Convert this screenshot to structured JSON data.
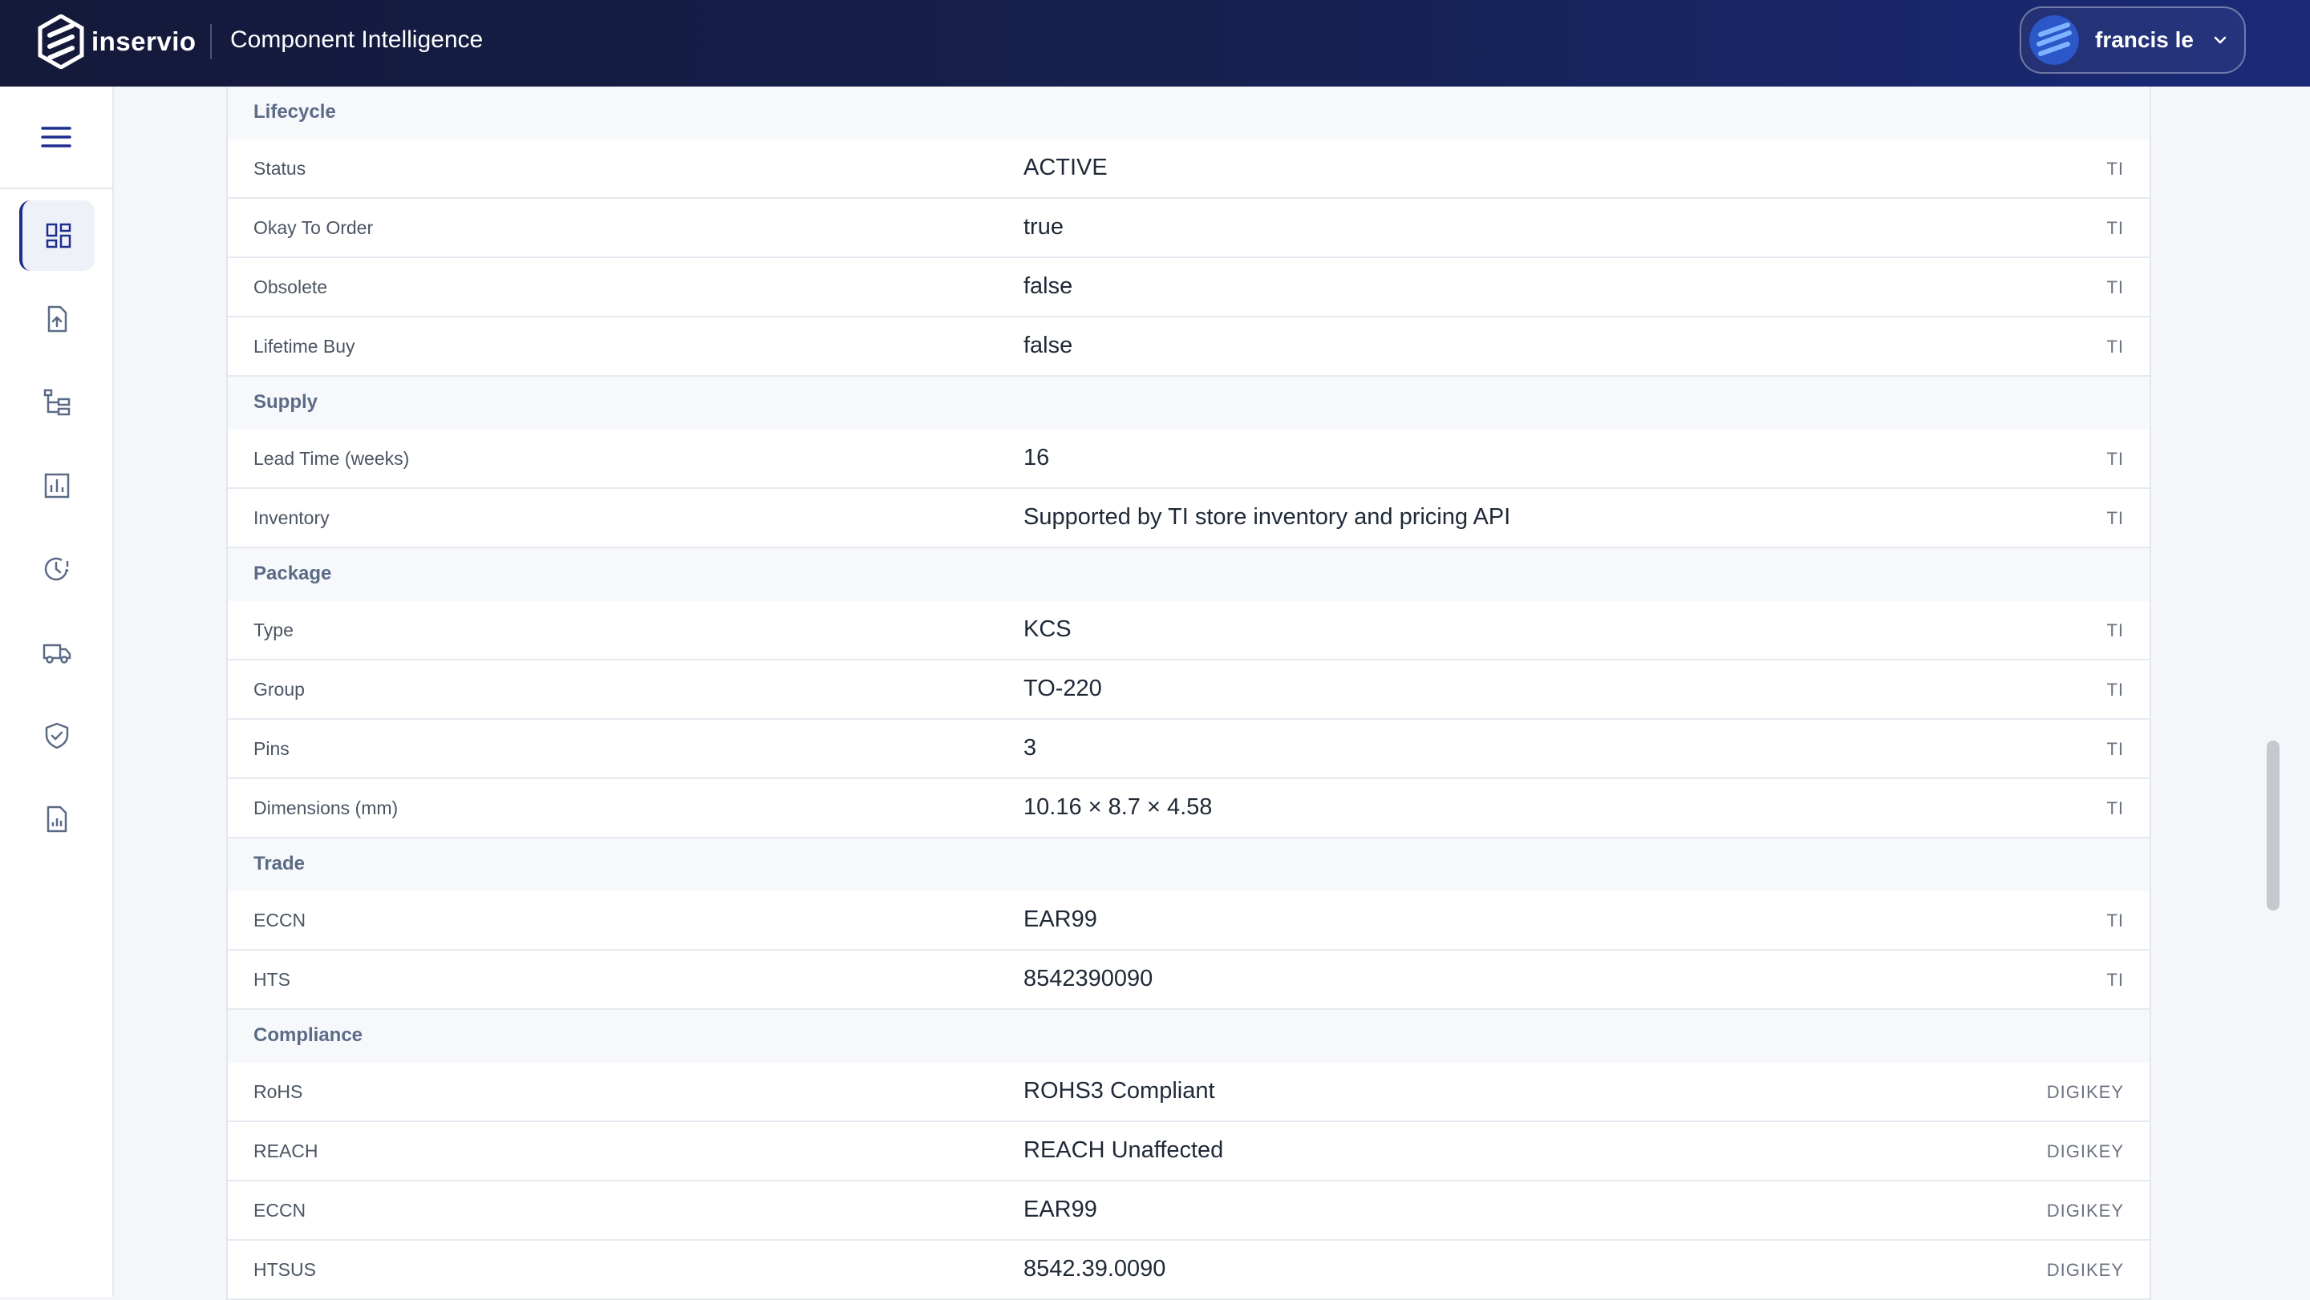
{
  "header": {
    "brand": "inservio",
    "app_title": "Component Intelligence",
    "user_name": "francis le"
  },
  "sidebar": {
    "items": [
      {
        "icon": "dashboard-icon",
        "active": true
      },
      {
        "icon": "file-upload-icon",
        "active": false
      },
      {
        "icon": "hierarchy-icon",
        "active": false
      },
      {
        "icon": "bar-chart-icon",
        "active": false
      },
      {
        "icon": "clock-alert-icon",
        "active": false
      },
      {
        "icon": "truck-icon",
        "active": false
      },
      {
        "icon": "shield-check-icon",
        "active": false
      },
      {
        "icon": "report-icon",
        "active": false
      }
    ]
  },
  "sections": [
    {
      "title": "Lifecycle",
      "rows": [
        {
          "label": "Status",
          "value": "ACTIVE",
          "source": "TI"
        },
        {
          "label": "Okay To Order",
          "value": "true",
          "source": "TI"
        },
        {
          "label": "Obsolete",
          "value": "false",
          "source": "TI"
        },
        {
          "label": "Lifetime Buy",
          "value": "false",
          "source": "TI"
        }
      ]
    },
    {
      "title": "Supply",
      "rows": [
        {
          "label": "Lead Time (weeks)",
          "value": "16",
          "source": "TI"
        },
        {
          "label": "Inventory",
          "value": "Supported by TI store inventory and pricing API",
          "source": "TI"
        }
      ]
    },
    {
      "title": "Package",
      "rows": [
        {
          "label": "Type",
          "value": "KCS",
          "source": "TI"
        },
        {
          "label": "Group",
          "value": "TO-220",
          "source": "TI"
        },
        {
          "label": "Pins",
          "value": "3",
          "source": "TI"
        },
        {
          "label": "Dimensions (mm)",
          "value": "10.16 × 8.7 × 4.58",
          "source": "TI"
        }
      ]
    },
    {
      "title": "Trade",
      "rows": [
        {
          "label": "ECCN",
          "value": "EAR99",
          "source": "TI"
        },
        {
          "label": "HTS",
          "value": "8542390090",
          "source": "TI"
        }
      ]
    },
    {
      "title": "Compliance",
      "rows": [
        {
          "label": "RoHS",
          "value": "ROHS3 Compliant",
          "source": "DIGIKEY"
        },
        {
          "label": "REACH",
          "value": "REACH Unaffected",
          "source": "DIGIKEY"
        },
        {
          "label": "ECCN",
          "value": "EAR99",
          "source": "DIGIKEY"
        },
        {
          "label": "HTSUS",
          "value": "8542.39.0090",
          "source": "DIGIKEY"
        }
      ]
    }
  ]
}
